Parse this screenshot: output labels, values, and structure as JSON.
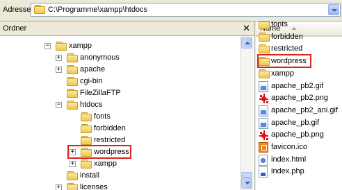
{
  "address": {
    "label": "Adresse",
    "path": "C:\\Programme\\xampp\\htdocs"
  },
  "tree_pane": {
    "title": "Ordner",
    "close_glyph": "✕"
  },
  "tree": [
    {
      "name": "xampp",
      "expander": "−"
    },
    {
      "name": "anonymous",
      "expander": "+"
    },
    {
      "name": "apache",
      "expander": "+"
    },
    {
      "name": "cgi-bin",
      "expander": ""
    },
    {
      "name": "FileZillaFTP",
      "expander": ""
    },
    {
      "name": "htdocs",
      "expander": "−"
    },
    {
      "name": "fonts",
      "expander": ""
    },
    {
      "name": "forbidden",
      "expander": ""
    },
    {
      "name": "restricted",
      "expander": ""
    },
    {
      "name": "wordpress",
      "expander": "+",
      "highlighted": true
    },
    {
      "name": "xampp",
      "expander": "+"
    },
    {
      "name": "install",
      "expander": ""
    },
    {
      "name": "licenses",
      "expander": "+"
    }
  ],
  "list_header": {
    "name": "Name"
  },
  "files": [
    {
      "name": "fonts",
      "icon": "folder-icon"
    },
    {
      "name": "forbidden",
      "icon": "folder-icon"
    },
    {
      "name": "restricted",
      "icon": "folder-icon"
    },
    {
      "name": "wordpress",
      "icon": "folder-icon",
      "highlighted": true
    },
    {
      "name": "xampp",
      "icon": "folder-icon"
    },
    {
      "name": "apache_pb2.gif",
      "icon": "gif-image-icon"
    },
    {
      "name": "apache_pb2.png",
      "icon": "png-image-icon"
    },
    {
      "name": "apache_pb2_ani.gif",
      "icon": "gif-image-icon"
    },
    {
      "name": "apache_pb.gif",
      "icon": "gif-image-icon"
    },
    {
      "name": "apache_pb.png",
      "icon": "png-image-icon"
    },
    {
      "name": "favicon.ico",
      "icon": "ico-icon"
    },
    {
      "name": "index.html",
      "icon": "html-file-icon"
    },
    {
      "name": "index.php",
      "icon": "php-file-icon"
    }
  ],
  "colors": {
    "highlight": "#e02020",
    "pane_bg": "#ffffff",
    "chrome": "#ece9d8"
  }
}
